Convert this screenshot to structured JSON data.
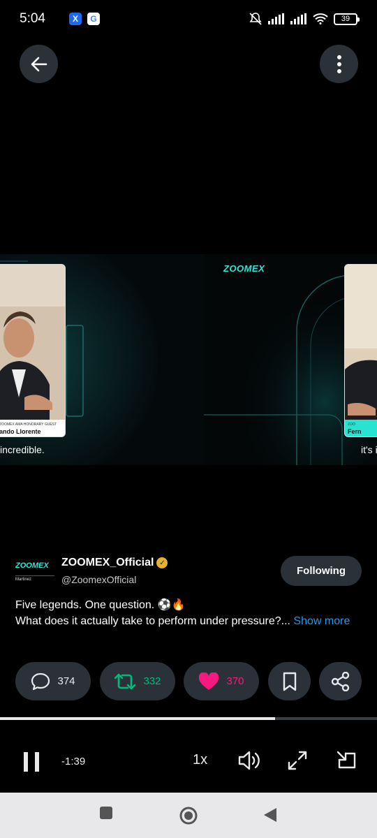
{
  "status_bar": {
    "time": "5:04",
    "battery": "39",
    "apps": [
      "X",
      "G"
    ]
  },
  "video": {
    "brand_logo": "ZOOMEX",
    "left_card": {
      "guest_label": "ZOOMEX AMA HONORARY GUEST",
      "name": "ando Llorente"
    },
    "right_card": {
      "guest_label": "ZOO",
      "name": "Fern"
    },
    "subtitle_left": "incredible.",
    "subtitle_right": "it's i"
  },
  "author": {
    "avatar_logo_top": "ZOOMEX",
    "avatar_logo_bottom": "Martinez",
    "name": "ZOOMEX_Official",
    "handle": "@ZoomexOfficial",
    "follow_label": "Following"
  },
  "tweet": {
    "line1": "Five legends. One question. ⚽🔥",
    "line2": "What does it actually take to perform under pressure?...",
    "show_more": "Show more"
  },
  "actions": {
    "replies": "374",
    "retweets": "332",
    "likes": "370"
  },
  "player": {
    "progress": 0.73,
    "time_remaining": "-1:39",
    "speed": "1x"
  },
  "colors": {
    "accent_teal": "#2ee6d6",
    "retweet_green": "#00ba7c",
    "like_pink": "#f91880",
    "link_blue": "#1d9bf0",
    "pill_bg": "#2a3138"
  }
}
